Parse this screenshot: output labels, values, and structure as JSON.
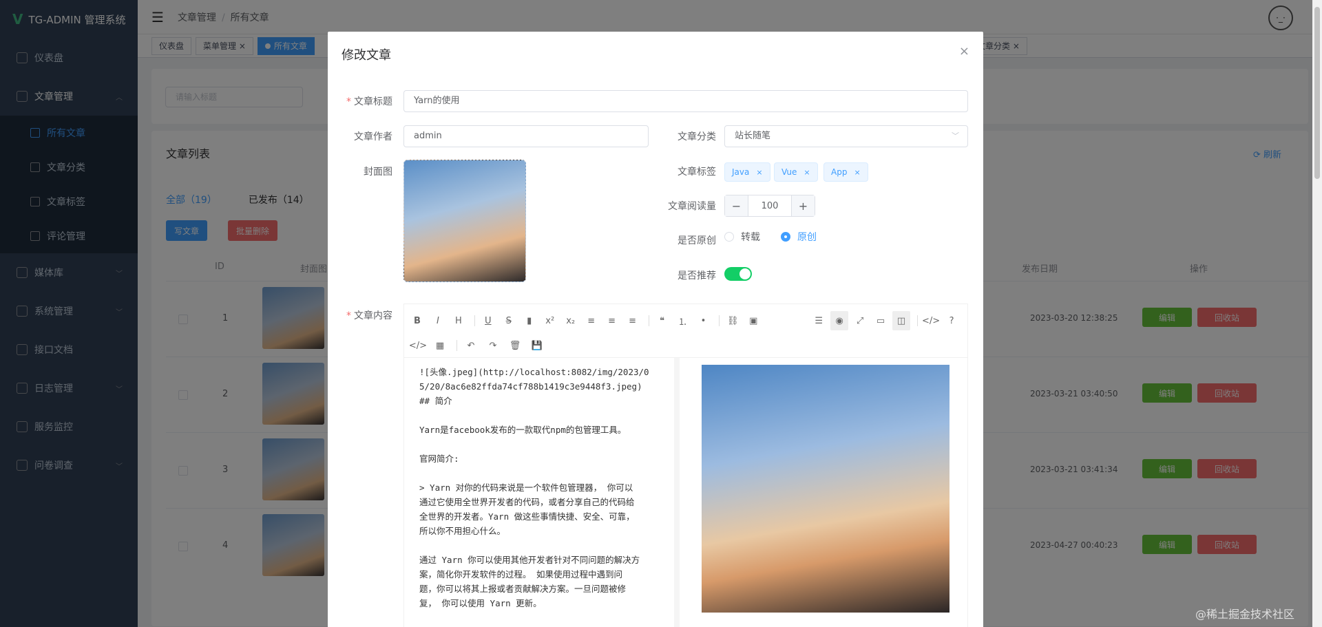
{
  "app": {
    "title": "TG-ADMIN 管理系统"
  },
  "sidebar": {
    "items": [
      {
        "label": "仪表盘"
      },
      {
        "label": "文章管理"
      },
      {
        "label": "所有文章"
      },
      {
        "label": "文章分类"
      },
      {
        "label": "文章标签"
      },
      {
        "label": "评论管理"
      },
      {
        "label": "媒体库"
      },
      {
        "label": "系统管理"
      },
      {
        "label": "接口文档"
      },
      {
        "label": "日志管理"
      },
      {
        "label": "服务监控"
      },
      {
        "label": "问卷调查"
      }
    ]
  },
  "navbar": {
    "crumb1": "文章管理",
    "sep": "/",
    "crumb2": "所有文章",
    "avatar": "·_·"
  },
  "tags": [
    {
      "label": "仪表盘"
    },
    {
      "label": "菜单管理"
    },
    {
      "label": "所有文章"
    },
    {
      "label": "文章分类"
    }
  ],
  "list": {
    "search_placeholder": "请输入标题",
    "title": "文章列表",
    "refresh": "刷新",
    "tabs": [
      {
        "label": "全部（19）"
      },
      {
        "label": "已发布（14）"
      }
    ],
    "write_btn": "写文章",
    "batch_delete_btn": "批量删除",
    "headers": {
      "id": "ID",
      "cover": "封面图",
      "date": "发布日期",
      "action": "操作"
    },
    "rows": [
      {
        "id": "1",
        "date": "2023-03-20 12:38:25"
      },
      {
        "id": "2",
        "date": "2023-03-21 03:40:50"
      },
      {
        "id": "3",
        "date": "2023-03-21 03:41:34"
      },
      {
        "id": "4",
        "date": "2023-04-27 00:40:23"
      }
    ],
    "edit_btn": "编辑",
    "recycle_btn": "回收站"
  },
  "dialog": {
    "title": "修改文章",
    "close": "×",
    "labels": {
      "title": "文章标题",
      "author": "文章作者",
      "category": "文章分类",
      "cover": "封面图",
      "tags": "文章标签",
      "views": "文章阅读量",
      "original": "是否原创",
      "recommend": "是否推荐",
      "content": "文章内容"
    },
    "values": {
      "title": "Yarn的使用",
      "author": "admin",
      "category": "站长随笔",
      "tags": [
        "Java",
        "Vue",
        "App"
      ],
      "views": "100",
      "original_options": [
        "转载",
        "原创"
      ],
      "original_selected": "原创",
      "recommend": true
    },
    "editor_text": "![头像.jpeg](http://localhost:8082/img/2023/0\n5/20/8ac6e82ffda74cf788b1419c3e9448f3.jpeg)\n## 简介\n\nYarn是facebook发布的一款取代npm的包管理工具。\n\n官网简介:\n\n> Yarn 对你的代码来说是一个软件包管理器， 你可以\n通过它使用全世界开发者的代码，或者分享自己的代码给\n全世界的开发者。Yarn 做这些事情快捷、安全、可靠，\n所以你不用担心什么。\n\n通过 Yarn 你可以使用其他开发者针对不同问题的解决方\n案，简化你开发软件的过程。 如果使用过程中遇到问\n题，你可以将其上报或者贡献解决方案。一旦问题被修\n复， 你可以使用 Yarn 更新。",
    "toolbar_row1": [
      "bold-icon",
      "italic-icon",
      "heading-icon",
      "underline-icon",
      "strikethrough-icon",
      "mark-icon",
      "superscript-icon",
      "subscript-icon",
      "align-left-icon",
      "align-center-icon",
      "align-right-icon",
      "quote-icon",
      "ordered-list-icon",
      "unordered-list-icon",
      "link-icon",
      "image-icon",
      "navigation-icon",
      "preview-icon",
      "fullscreen-icon",
      "subfield-icon",
      "split-icon",
      "code-icon",
      "help-icon"
    ],
    "toolbar_row2": [
      "code-block-icon",
      "table-icon",
      "undo-icon",
      "redo-icon",
      "trash-icon",
      "save-icon"
    ]
  },
  "watermark": "@稀土掘金技术社区",
  "colors": {
    "primary": "#409eff",
    "success": "#67c23a",
    "danger": "#f56c6c",
    "sidebar": "#304156",
    "switch_on": "#13ce66"
  }
}
